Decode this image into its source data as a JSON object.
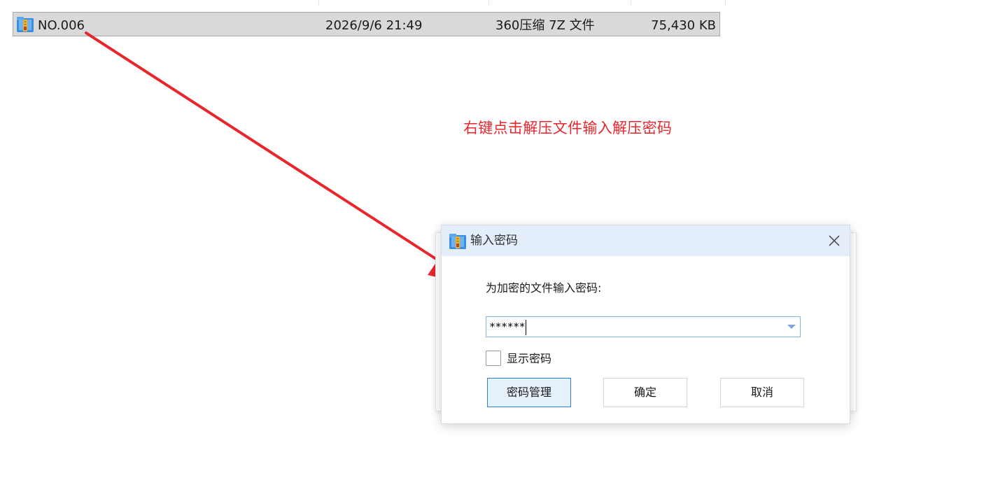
{
  "file_row": {
    "name": "NO.006",
    "date_modified": "2026/9/6 21:49",
    "type": "360压缩 7Z 文件",
    "size": "75,430 KB",
    "icon": "archive-icon"
  },
  "annotation": {
    "text": "右键点击解压文件输入解压密码",
    "color": "#e8262c"
  },
  "dialog": {
    "title": "输入密码",
    "title_icon": "archive-icon",
    "prompt": "为加密的文件输入密码:",
    "password_value": "******",
    "show_password_label": "显示密码",
    "show_password_checked": false,
    "buttons": {
      "manage": "密码管理",
      "ok": "确定",
      "cancel": "取消"
    },
    "accent_color": "#2c7ed6",
    "titlebar_color": "#e3eefa"
  }
}
